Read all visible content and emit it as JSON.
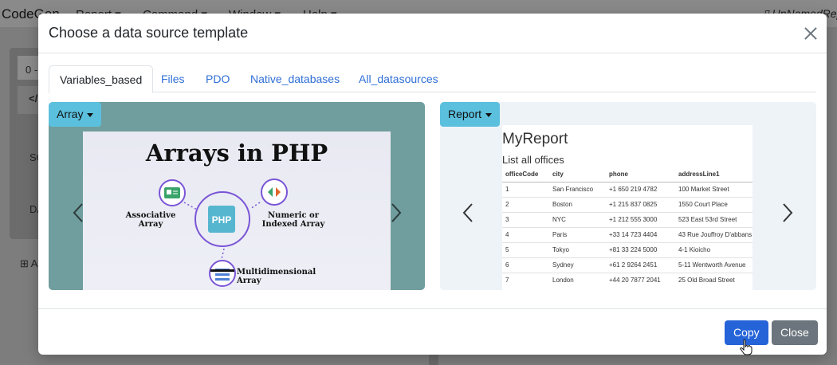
{
  "app": {
    "brand": "CodeGen",
    "menus": [
      "Report",
      "Command",
      "Window",
      "Help"
    ],
    "file_name": "UnNamedRep",
    "bg_texts": [
      "0 -",
      "</",
      "SC",
      "DA",
      "A"
    ]
  },
  "modal": {
    "title": "Choose a data source template",
    "tabs": [
      "Variables_based",
      "Files",
      "PDO",
      "Native_databases",
      "All_datasources"
    ],
    "active_tab": "Variables_based",
    "left_card": {
      "dropdown_label": "Array",
      "image": {
        "title": "Arrays in PHP",
        "center_label": "PHP",
        "labels": [
          "Associative Array",
          "Numeric or Indexed Array",
          "Multidimensional Array"
        ]
      }
    },
    "right_card": {
      "dropdown_label": "Report",
      "image": {
        "title": "MyReport",
        "subtitle": "List all offices",
        "columns": [
          "officeCode",
          "city",
          "phone",
          "addressLine1"
        ],
        "rows": [
          [
            "1",
            "San Francisco",
            "+1 650 219 4782",
            "100 Market Street"
          ],
          [
            "2",
            "Boston",
            "+1 215 837 0825",
            "1550 Court Place"
          ],
          [
            "3",
            "NYC",
            "+1 212 555 3000",
            "523 East 53rd Street"
          ],
          [
            "4",
            "Paris",
            "+33 14 723 4404",
            "43 Rue Jouffroy D'abbans"
          ],
          [
            "5",
            "Tokyo",
            "+81 33 224 5000",
            "4-1 Kioicho"
          ],
          [
            "6",
            "Sydney",
            "+61 2 9264 2451",
            "5-11 Wentworth Avenue"
          ],
          [
            "7",
            "London",
            "+44 20 7877 2041",
            "25 Old Broad Street"
          ]
        ]
      }
    },
    "buttons": {
      "copy": "Copy",
      "close": "Close"
    }
  },
  "colors": {
    "accent": "#2563d8",
    "dropdown": "#5bc0de",
    "left_card_bg": "#709d9d",
    "secondary": "#6c757d"
  }
}
